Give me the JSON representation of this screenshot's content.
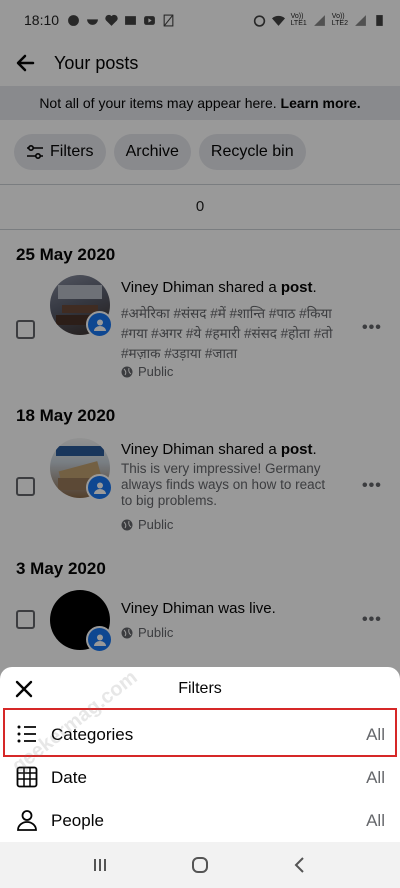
{
  "status_bar": {
    "time": "18:10",
    "network_1": "Vo))\nLTE1",
    "network_2": "Vo))\nLTE2"
  },
  "header": {
    "title": "Your posts"
  },
  "notice": {
    "text": "Not all of your items may appear here.",
    "link": "Learn more."
  },
  "chips": {
    "filters": "Filters",
    "archive": "Archive",
    "recycle_bin": "Recycle bin"
  },
  "count": "0",
  "groups": [
    {
      "date": "25 May 2020",
      "post": {
        "author": "Viney Dhiman",
        "action": "shared a",
        "object": "post",
        "body": "#अमेरिका #संसद #में #शान्ति #पाठ #किया #गया #अगर #ये #हमारी #संसद #होता #तो #मज़ाक #उड़ाया #जाता",
        "privacy": "Public"
      }
    },
    {
      "date": "18 May 2020",
      "post": {
        "author": "Viney Dhiman",
        "action": "shared a",
        "object": "post",
        "body": "This is very impressive! Germany always finds ways on how to react to big problems.",
        "privacy": "Public"
      }
    },
    {
      "date": "3 May 2020",
      "post": {
        "author": "Viney Dhiman",
        "action": "was live.",
        "object": "",
        "body": "",
        "privacy": "Public"
      }
    }
  ],
  "sheet": {
    "title": "Filters",
    "rows": [
      {
        "label": "Categories",
        "value": "All"
      },
      {
        "label": "Date",
        "value": "All"
      },
      {
        "label": "People",
        "value": "All"
      }
    ]
  },
  "watermark": "geekermag.com",
  "colors": {
    "accent": "#1877f2",
    "highlight": "#d62828",
    "chip_bg": "#e4e6eb"
  }
}
